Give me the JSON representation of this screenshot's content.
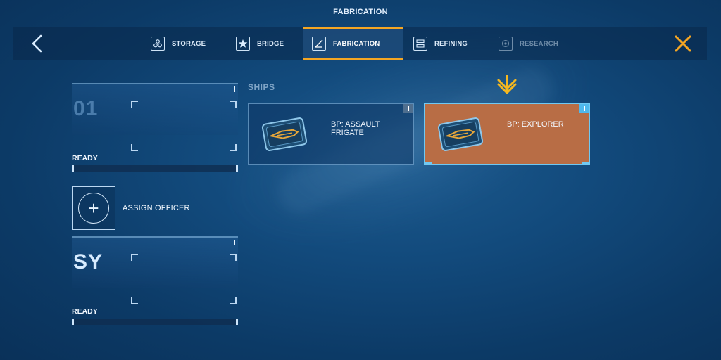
{
  "screen_title": "FABRICATION",
  "nav": {
    "back_icon": "chevron-left-icon",
    "close_icon": "close-x-icon",
    "tabs": [
      {
        "label": "STORAGE",
        "icon": "storage-icon",
        "state": "normal"
      },
      {
        "label": "BRIDGE",
        "icon": "star-icon",
        "state": "normal"
      },
      {
        "label": "FABRICATION",
        "icon": "fabrication-icon",
        "state": "active"
      },
      {
        "label": "REFINING",
        "icon": "refining-icon",
        "state": "normal"
      },
      {
        "label": "RESEARCH",
        "icon": "research-icon",
        "state": "disabled"
      }
    ]
  },
  "slots": [
    {
      "id": "01",
      "status": "READY"
    },
    {
      "id": "SY",
      "status": "READY"
    }
  ],
  "assign_officer": {
    "label": "ASSIGN OFFICER",
    "icon": "plus-icon"
  },
  "section": {
    "label": "SHIPS"
  },
  "blueprints": [
    {
      "title": "BP: ASSAULT FRIGATE",
      "icon": "blueprint-icon",
      "selected": false
    },
    {
      "title": "BP: EXPLORER",
      "icon": "blueprint-icon",
      "selected": true
    }
  ],
  "colors": {
    "accent_orange": "#f5a623",
    "selected_card": "#b86d45",
    "highlight_blue": "#6fc8f2",
    "background": "#124a7c"
  }
}
